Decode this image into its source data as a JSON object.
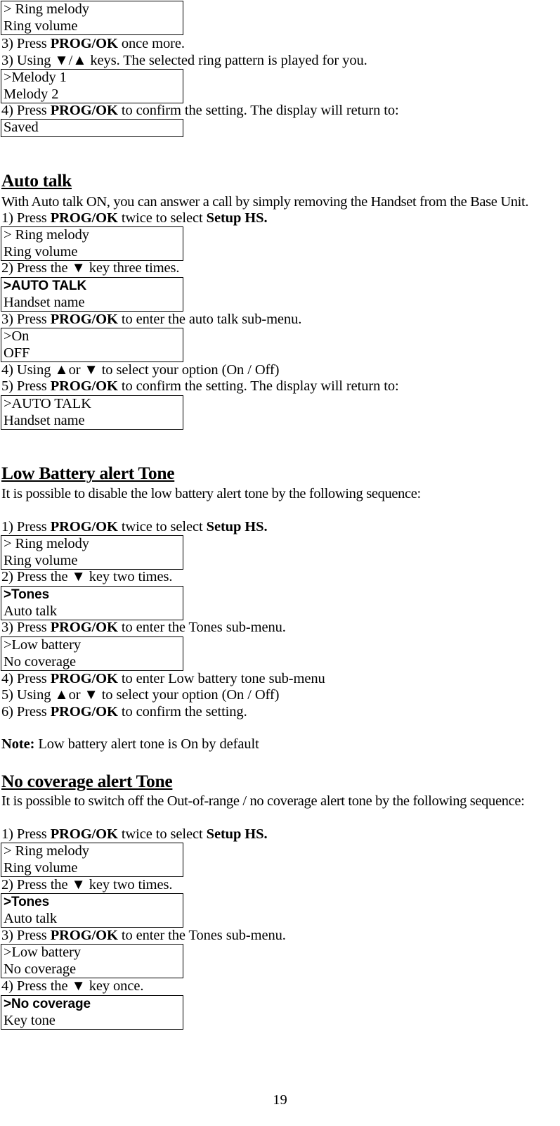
{
  "document": {
    "page_number": "19",
    "sections": [
      {
        "id": "ring-melody-continued",
        "steps": [
          "3)    Press PROG/OK once more.",
          "3) Using ▼/▲ keys. The selected ring pattern is played for you.",
          "4) Press PROG/OK to confirm the setting.  The display will return to:"
        ]
      },
      {
        "id": "auto-talk",
        "heading": "Auto talk",
        "intro": "With Auto talk ON, you can answer a call by simply removing the Handset from the Base Unit.",
        "steps": [
          "1) Press PROG/OK twice to select Setup HS.",
          "2) Press the ▼ key three times.",
          "3) Press PROG/OK to enter the auto talk sub-menu.",
          "4)    Using ▲or ▼ to select your option (On / Off)",
          "5) Press PROG/OK to confirm the setting.  The display will return to:"
        ]
      },
      {
        "id": "low-battery-alert-tone",
        "heading": "Low Battery alert Tone",
        "intro": "It is possible to disable the low battery alert tone by the following sequence:",
        "steps": [
          "1) Press PROG/OK twice to select Setup HS.",
          "2) Press the ▼ key two times.",
          "3) Press PROG/OK to enter the Tones sub-menu.",
          "4) Press PROG/OK to enter Low battery tone sub-menu",
          "5)  Using ▲or ▼ to select your option (On / Off)",
          "6) Press PROG/OK to confirm the setting."
        ],
        "note": "Note: Low battery alert tone is On by default"
      },
      {
        "id": "no-coverage-alert-tone",
        "heading": "No coverage alert Tone",
        "intro": "It is possible to switch off the Out-of-range / no coverage alert tone by the following sequence:",
        "steps": [
          "1) Press PROG/OK twice to select Setup HS.",
          "2) Press the ▼ key two times.",
          "3) Press PROG/OK to enter the Tones sub-menu.",
          "4) Press the ▼ key once."
        ]
      }
    ]
  },
  "text": {
    "t1_step3a_pre": "3)    Press ",
    "t1_step3a_bold": "PROG/OK",
    "t1_step3a_post": " once more.",
    "t1_step3b": "3) Using ▼/▲ keys. The selected ring pattern is played for you.",
    "t1_step4_pre": "4) Press ",
    "t1_step4_bold": "PROG/OK",
    "t1_step4_post": " to confirm the setting.  The display will return to:",
    "autotalk_heading": "Auto talk",
    "autotalk_intro": "With Auto talk ON, you can answer a call by simply removing the Handset from the Base Unit.",
    "autotalk_s1_pre": "1) Press ",
    "autotalk_s1_bold1": "PROG/OK",
    "autotalk_s1_mid": " twice to select ",
    "autotalk_s1_bold2": "Setup HS.",
    "autotalk_s2": "2) Press the ▼ key three times.",
    "autotalk_s3_pre": "3) Press ",
    "autotalk_s3_bold": "PROG/OK",
    "autotalk_s3_post": " to enter the auto talk sub-menu.",
    "autotalk_s4": "4)    Using ▲or ▼ to select your option (On / Off)",
    "autotalk_s5_pre": "5) Press ",
    "autotalk_s5_bold": "PROG/OK",
    "autotalk_s5_post": " to confirm the setting.  The display will return to:",
    "lowbatt_heading": "Low Battery alert Tone",
    "lowbatt_intro": "It is possible to disable the low battery alert tone by the following sequence:",
    "lowbatt_s1_pre": "1) Press ",
    "lowbatt_s1_bold1": "PROG/OK",
    "lowbatt_s1_mid": " twice to select ",
    "lowbatt_s1_bold2": "Setup HS.",
    "lowbatt_s2": "2) Press the ▼ key two times.",
    "lowbatt_s3_pre": "3) Press ",
    "lowbatt_s3_bold": "PROG/OK",
    "lowbatt_s3_post": " to enter the Tones sub-menu.",
    "lowbatt_s4_pre": "4) Press ",
    "lowbatt_s4_bold": "PROG/OK",
    "lowbatt_s4_post": " to enter Low battery tone sub-menu",
    "lowbatt_s5": "5)  Using ▲or ▼ to select your option (On / Off)",
    "lowbatt_s6_pre": "6) Press ",
    "lowbatt_s6_bold": "PROG/OK",
    "lowbatt_s6_post": " to confirm the setting.",
    "lowbatt_note_bold": "Note:",
    "lowbatt_note_post": " Low battery alert tone is On by default",
    "nocov_heading": "No coverage alert Tone",
    "nocov_intro": "It is possible to switch off the Out-of-range / no coverage alert tone by the following sequence:",
    "nocov_s1_pre": "1) Press ",
    "nocov_s1_bold1": "PROG/OK",
    "nocov_s1_mid": " twice to select ",
    "nocov_s1_bold2": "Setup HS.",
    "nocov_s2": "2) Press the ▼ key two times.",
    "nocov_s3_pre": "3) Press ",
    "nocov_s3_bold": "PROG/OK",
    "nocov_s3_post": " to enter the Tones sub-menu.",
    "nocov_s4": "4) Press the ▼ key once."
  },
  "lcd_screens": {
    "box1": {
      "line1": "> Ring melody",
      "line2": "Ring volume"
    },
    "box2": {
      "line1": ">Melody 1",
      "line2": " Melody 2"
    },
    "box3": {
      "line1": "Saved"
    },
    "box4": {
      "line1": "> Ring melody",
      "line2": "Ring volume"
    },
    "box5": {
      "line1": ">AUTO TALK",
      "line2": " Handset name"
    },
    "box6": {
      "line1": ">On",
      "line2": "OFF"
    },
    "box7": {
      "line1": ">AUTO TALK",
      "line2": " Handset name"
    },
    "box8": {
      "line1": "> Ring melody",
      "line2": "Ring volume"
    },
    "box9": {
      "line1": ">Tones",
      "line2": "Auto talk"
    },
    "box10": {
      "line1": ">Low battery",
      "line2": " No coverage"
    },
    "box11": {
      "line1": "> Ring melody",
      "line2": "Ring volume"
    },
    "box12": {
      "line1": ">Tones",
      "line2": "Auto talk"
    },
    "box13": {
      "line1": ">Low battery",
      "line2": " No coverage"
    },
    "box14": {
      "line1": ">No coverage",
      "line2": " Key tone"
    }
  },
  "footer": {
    "page_number": "19"
  }
}
